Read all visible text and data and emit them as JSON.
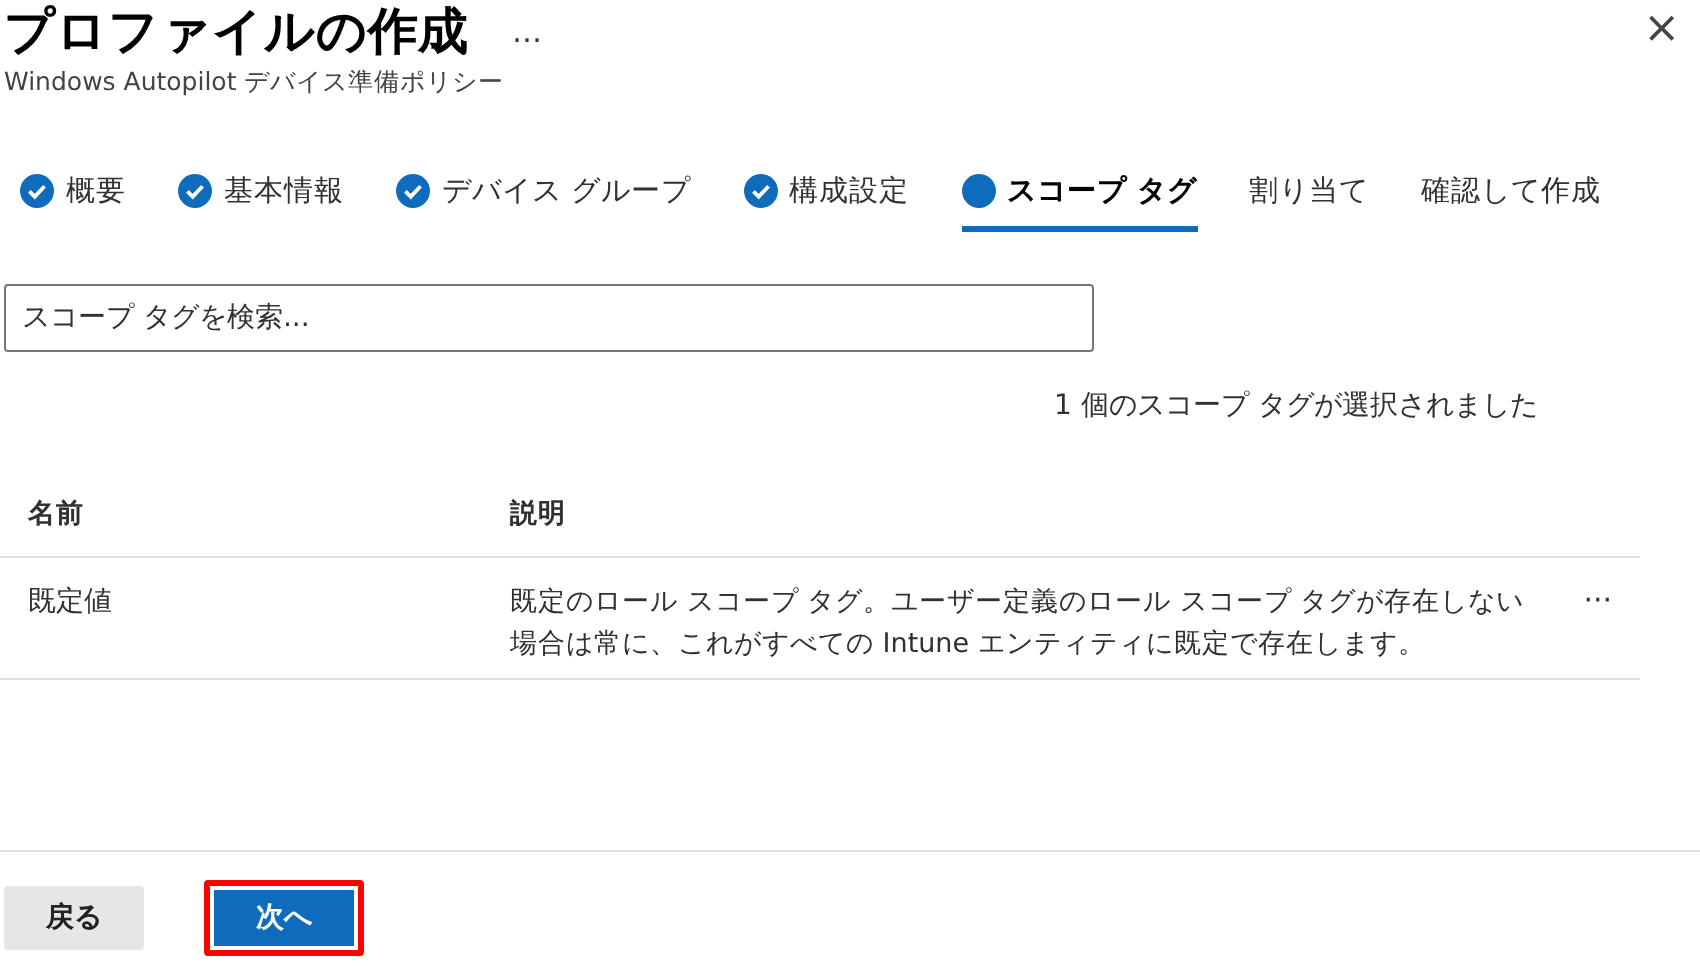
{
  "header": {
    "title": "プロファイルの作成",
    "more": "…",
    "subtitle": "Windows Autopilot デバイス準備ポリシー",
    "close": "×"
  },
  "steps": [
    {
      "label": "概要",
      "kind": "done",
      "selected": false
    },
    {
      "label": "基本情報",
      "kind": "done",
      "selected": false
    },
    {
      "label": "デバイス グループ",
      "kind": "done",
      "selected": false
    },
    {
      "label": "構成設定",
      "kind": "done",
      "selected": false
    },
    {
      "label": "スコープ タグ",
      "kind": "current",
      "selected": true
    },
    {
      "label": "割り当て",
      "kind": "pending",
      "selected": false
    },
    {
      "label": "確認して作成",
      "kind": "pending",
      "selected": false
    }
  ],
  "search": {
    "placeholder": "スコープ タグを検索..."
  },
  "selection_summary": "1 個のスコープ タグが選択されました",
  "table": {
    "columns": [
      "名前",
      "説明"
    ],
    "rows": [
      {
        "name": "既定値",
        "description": "既定のロール スコープ タグ。ユーザー定義のロール スコープ タグが存在しない場合は常に、これがすべての Intune エンティティに既定で存在します。",
        "more": "···"
      }
    ]
  },
  "buttons": [
    {
      "label": "戻る",
      "kind": "secondary",
      "highlighted": false
    },
    {
      "label": "次へ",
      "kind": "primary",
      "highlighted": true
    }
  ]
}
